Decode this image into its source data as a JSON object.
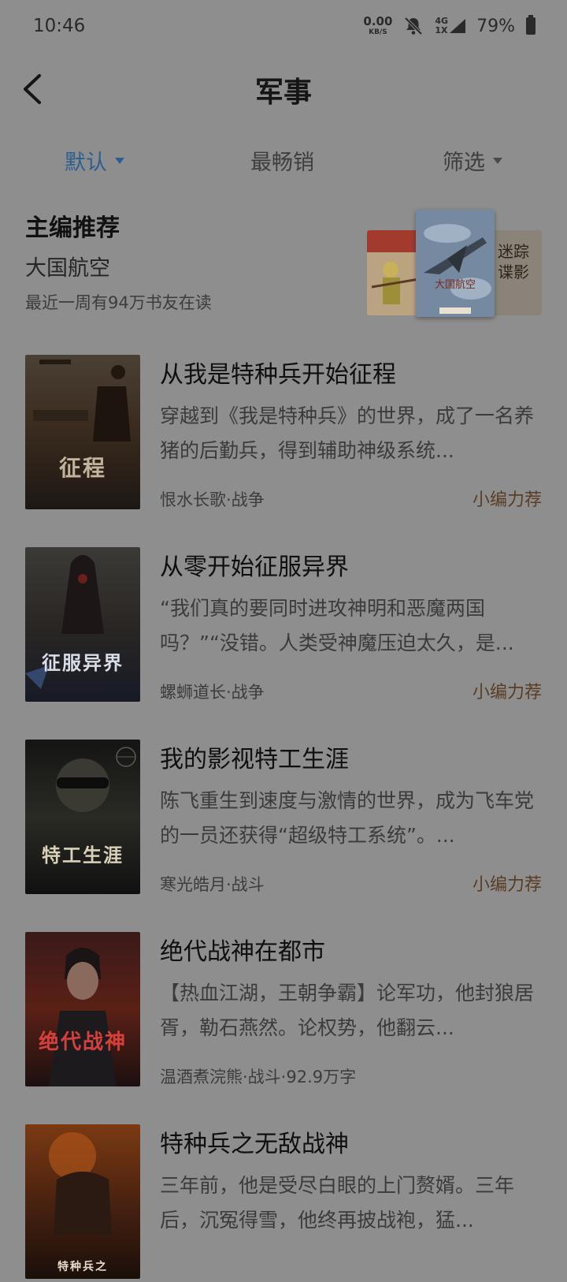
{
  "status_bar": {
    "time": "10:46",
    "net_speed_value": "0.00",
    "net_speed_unit": "KB/S",
    "network_top": "4G",
    "network_bottom": "1X",
    "battery": "79%"
  },
  "nav": {
    "title": "军事"
  },
  "filters": {
    "default_label": "默认",
    "bestseller_label": "最畅销",
    "filter_label": "筛选"
  },
  "editor_pick": {
    "heading": "主编推荐",
    "book": "大国航空",
    "readers": "最近一周有94万书友在读",
    "center_cover_title": "大国航空",
    "right_cover_title": "迷踪谍影"
  },
  "books": [
    {
      "title": "从我是特种兵开始征程",
      "desc": "穿越到《我是特种兵》的世界，成了一名养猪的后勤兵，得到辅助神级系统...",
      "meta": "恨水长歌·战争",
      "tag": "小编力荐",
      "cover_text": "征程"
    },
    {
      "title": "从零开始征服异界",
      "desc": "“我们真的要同时进攻神明和恶魔两国吗？”“没错。人类受神魔压迫太久，是...",
      "meta": "螺蛳道长·战争",
      "tag": "小编力荐",
      "cover_text": "征服异界"
    },
    {
      "title": "我的影视特工生涯",
      "desc": "陈飞重生到速度与激情的世界，成为飞车党的一员还获得“超级特工系统”。...",
      "meta": "寒光皓月·战斗",
      "tag": "小编力荐",
      "cover_text": "特工生涯"
    },
    {
      "title": "绝代战神在都市",
      "desc": "【热血江湖，王朝争霸】论军功，他封狼居胥，勒石燕然。论权势，他翻云...",
      "meta": "温酒煮浣熊·战斗·92.9万字",
      "tag": "",
      "cover_text": "绝代战神"
    },
    {
      "title": "特种兵之无敌战神",
      "desc": "三年前，他是受尽白眼的上门赘婿。三年后，沉冤得雪，他终再披战袍，猛...",
      "meta": "",
      "tag": "",
      "cover_text": "特种兵之"
    }
  ],
  "colors": {
    "active_filter": "#2a5f92",
    "tag": "#5a3d25",
    "overlay_background": "#8e8e8e"
  }
}
